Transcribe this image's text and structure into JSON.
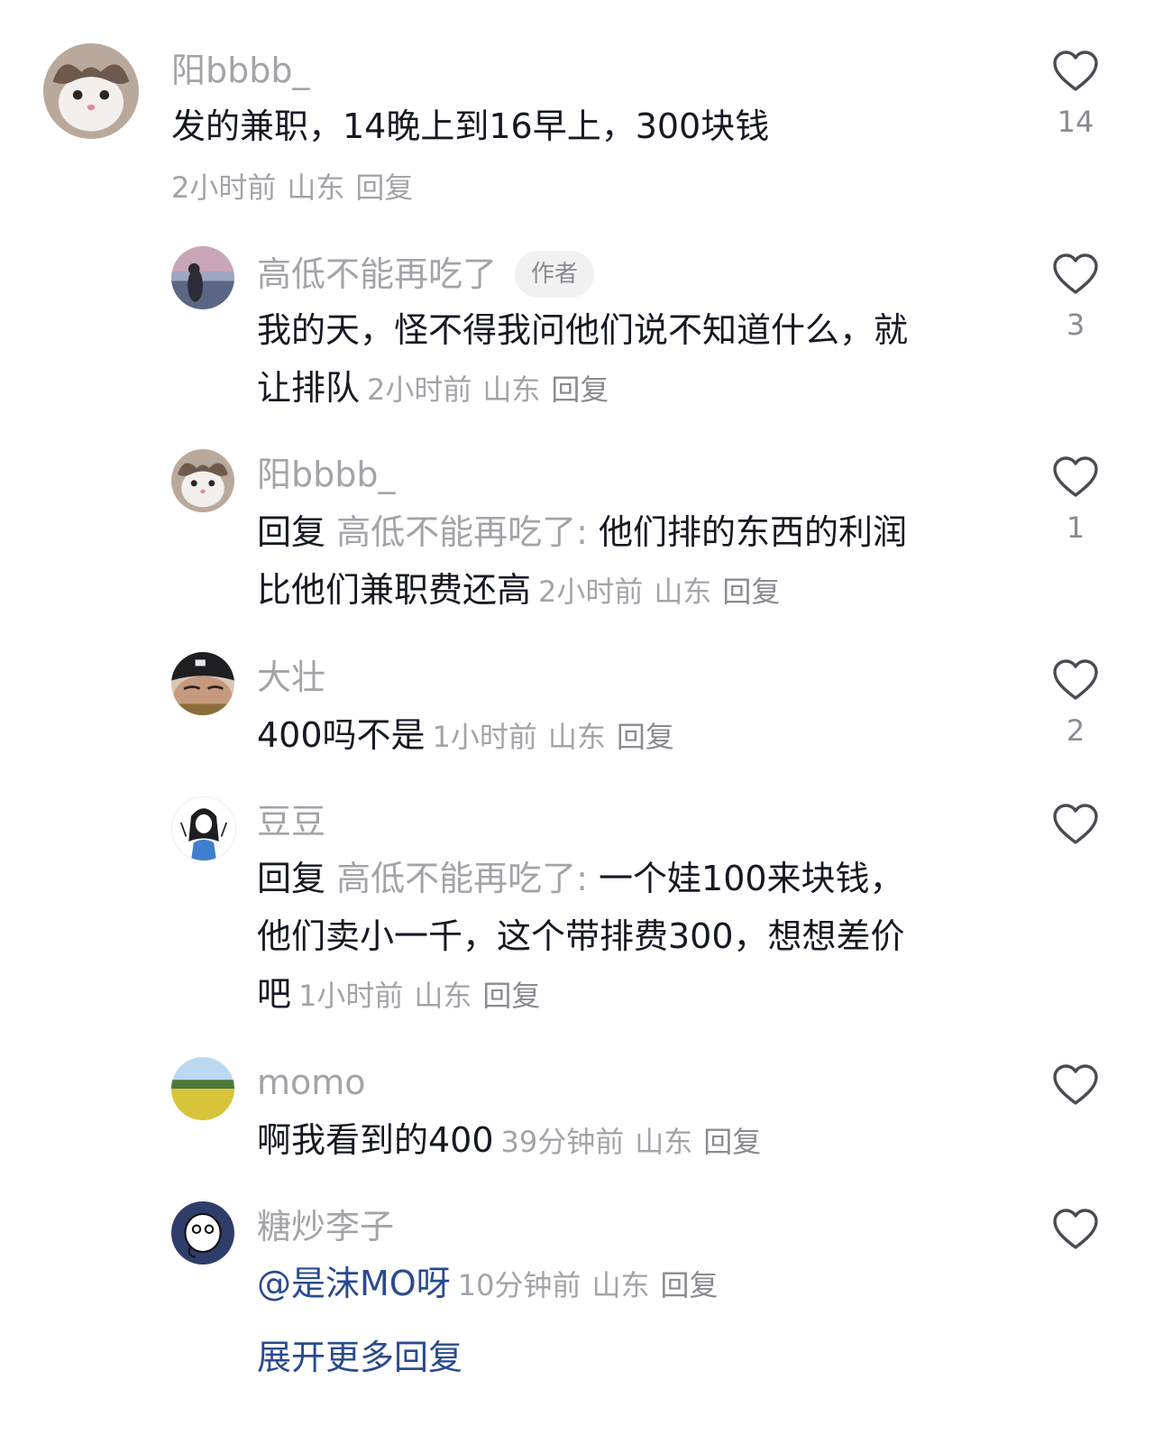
{
  "comments": [
    {
      "username": "阳bbbb_",
      "text": "发的兼职，14晚上到16早上，300块钱",
      "time": "2小时前",
      "location": "山东",
      "reply_label": "回复",
      "likes": "14",
      "avatar_icon": "cat-avatar-icon"
    }
  ],
  "replies": [
    {
      "username": "高低不能再吃了",
      "badge": "作者",
      "line1": "我的天，怪不得我问他们说不知道什么，就",
      "line2": "让排队",
      "time": "2小时前",
      "location": "山东",
      "reply_label": "回复",
      "likes": "3",
      "avatar_icon": "sunset-photo-avatar-icon"
    },
    {
      "username": "阳bbbb_",
      "reply_prefix": "回复",
      "reply_target": "高低不能再吃了:",
      "line1_rest": "他们排的东西的利润",
      "line2": "比他们兼职费还高",
      "time": "2小时前",
      "location": "山东",
      "reply_label": "回复",
      "likes": "1",
      "avatar_icon": "cat-avatar-icon"
    },
    {
      "username": "大壮",
      "line1": "400吗不是",
      "time": "1小时前",
      "location": "山东",
      "reply_label": "回复",
      "likes": "2",
      "avatar_icon": "person-cap-avatar-icon"
    },
    {
      "username": "豆豆",
      "reply_prefix": "回复",
      "reply_target": "高低不能再吃了:",
      "line1_rest": "一个娃100来块钱，",
      "line2": "他们卖小一千，这个带排费300，想想差价",
      "line3": "吧",
      "time": "1小时前",
      "location": "山东",
      "reply_label": "回复",
      "likes": "",
      "avatar_icon": "cartoon-girl-avatar-icon"
    },
    {
      "username": "momo",
      "line1": "啊我看到的400",
      "time": "39分钟前",
      "location": "山东",
      "reply_label": "回复",
      "likes": "",
      "avatar_icon": "field-photo-avatar-icon"
    },
    {
      "username": "糖炒李子",
      "mention": "@是沫MO呀",
      "time": "10分钟前",
      "location": "山东",
      "reply_label": "回复",
      "likes": "",
      "avatar_icon": "cartoon-cat-avatar-icon"
    }
  ],
  "expand_more": "展开更多回复",
  "colors": {
    "text": "#161823",
    "secondary": "#a3a4a8",
    "mention": "#2a4a8e",
    "badge_bg": "#f1f1f2"
  }
}
